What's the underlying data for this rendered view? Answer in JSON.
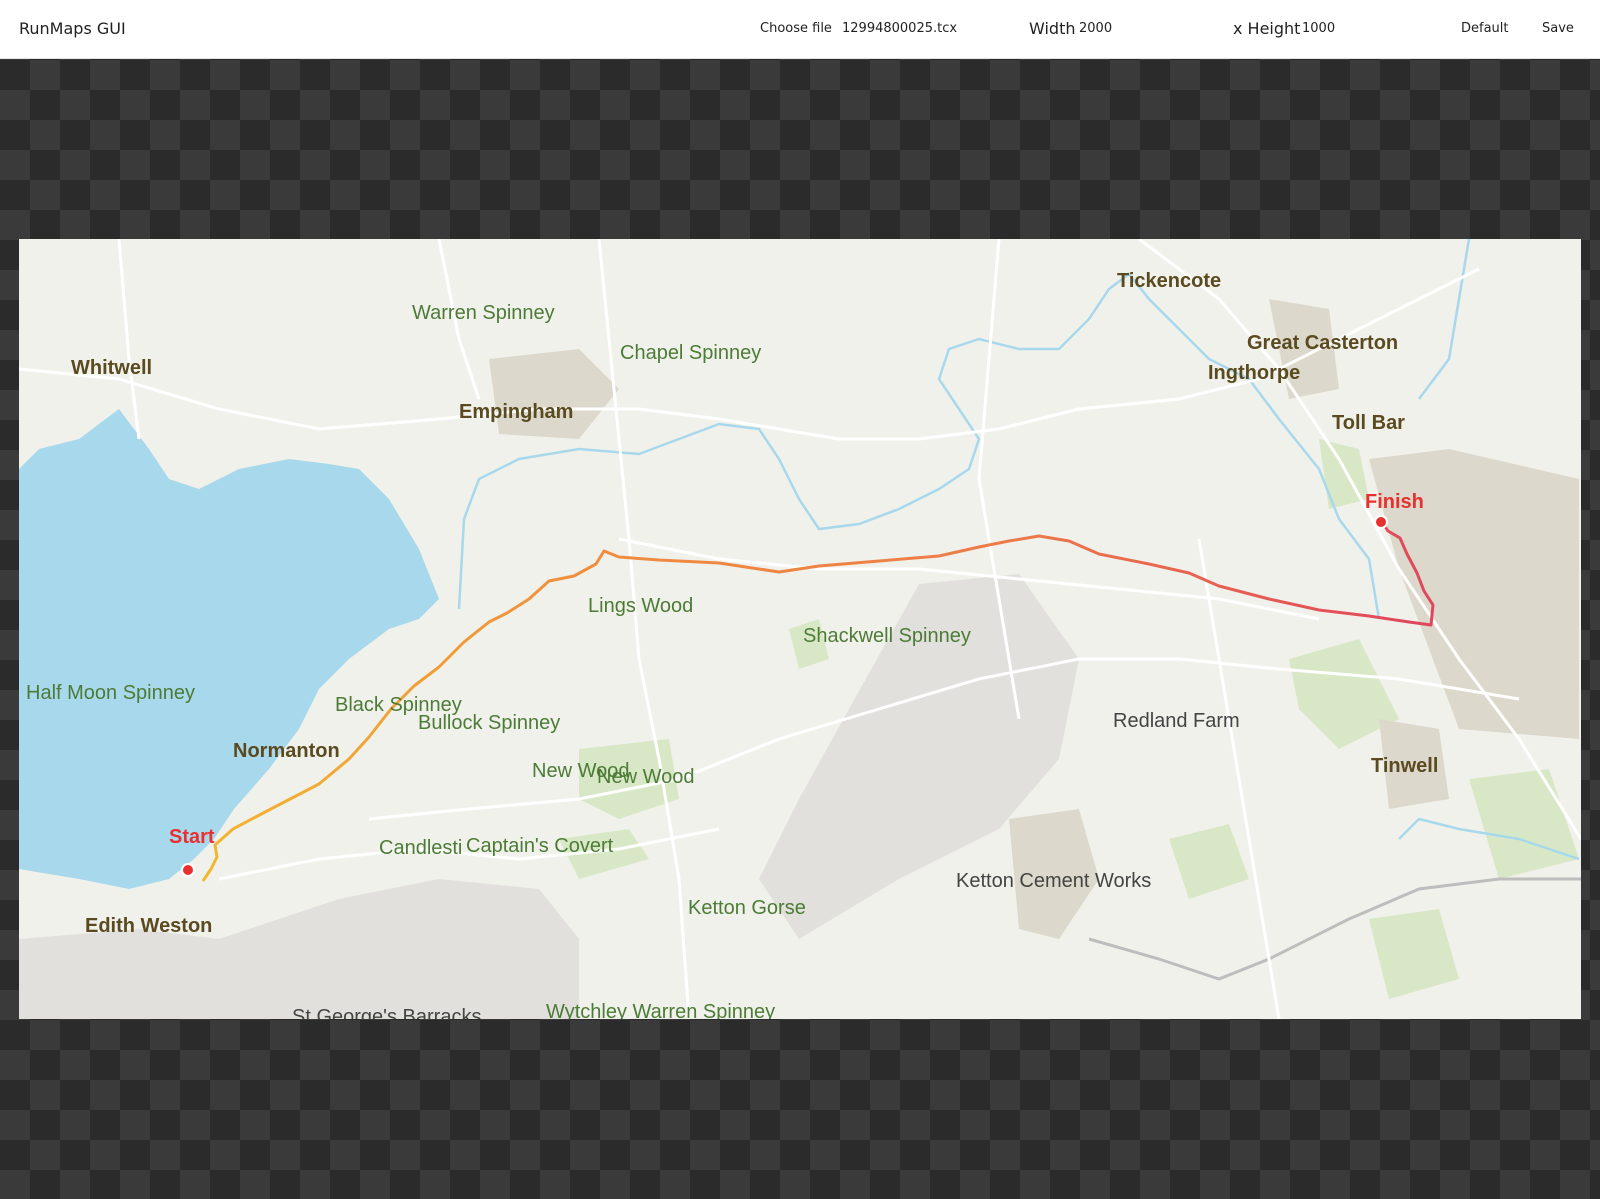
{
  "app": {
    "title": "RunMaps GUI"
  },
  "toolbar": {
    "choose_file_label": "Choose file",
    "file_name": "12994800025.tcx",
    "width_label": "Width",
    "width_value": "2000",
    "height_label": "x Height",
    "height_value": "1000",
    "default_label": "Default",
    "save_label": "Save"
  },
  "map": {
    "markers": {
      "start": "Start",
      "finish": "Finish"
    },
    "route_colors": {
      "start": "#f2b632",
      "middle": "#ef8f3d",
      "end": "#e0465c"
    },
    "water_color": "#a8d8ec",
    "labels": {
      "whitwell": "Whitwell",
      "warren_spinney": "Warren Spinney",
      "chapel_spinney": "Chapel Spinney",
      "empingham": "Empingham",
      "tickencote": "Tickencote",
      "great_casterton": "Great Casterton",
      "ingthorpe": "Ingthorpe",
      "toll_bar": "Toll Bar",
      "lings_wood": "Lings Wood",
      "shackwell_spinney": "Shackwell Spinney",
      "half_moon_spinney": "Half Moon Spinney",
      "black_spinney": "Black Spinney",
      "bullock_spinney": "Bullock Spinney",
      "normanton": "Normanton",
      "new_wood_1": "New Wood",
      "new_wood_2": "New Wood",
      "redland_farm": "Redland Farm",
      "tinwell": "Tinwell",
      "candlestick": "Candlesti",
      "captains_covert": "Captain's Covert",
      "ketton_cement_works": "Ketton Cement Works",
      "ketton_gorse": "Ketton Gorse",
      "edith_weston": "Edith Weston",
      "st_georges_barracks": "St George's Barracks",
      "wytchley_warren_spinney": "Wytchley Warren Spinney"
    }
  }
}
